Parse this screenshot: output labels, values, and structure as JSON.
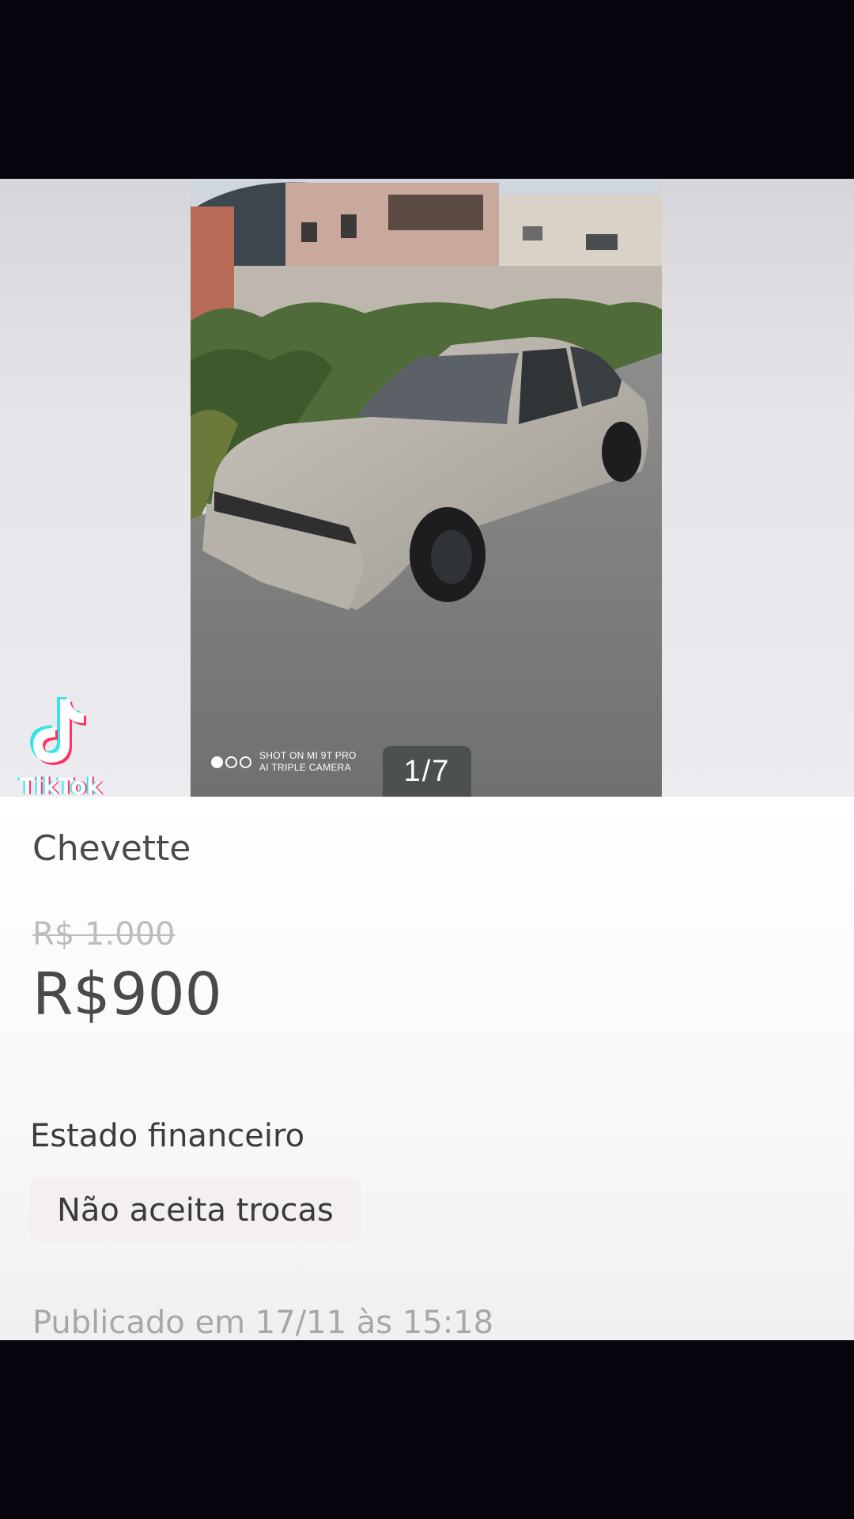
{
  "gallery": {
    "counter": "1/7",
    "watermark_line1": "SHOT ON MI 9T PRO",
    "watermark_line2": "AI TRIPLE CAMERA",
    "tiktok_wordmark": "TikTok"
  },
  "listing": {
    "title": "Chevette",
    "old_price": "R$ 1.000",
    "price": "R$900",
    "section_heading": "Estado financeiro",
    "chip_label": "Não aceita trocas",
    "published": "Publicado em 17/11 às 15:18"
  },
  "icons": {
    "tiktok": "tiktok-note-icon"
  }
}
